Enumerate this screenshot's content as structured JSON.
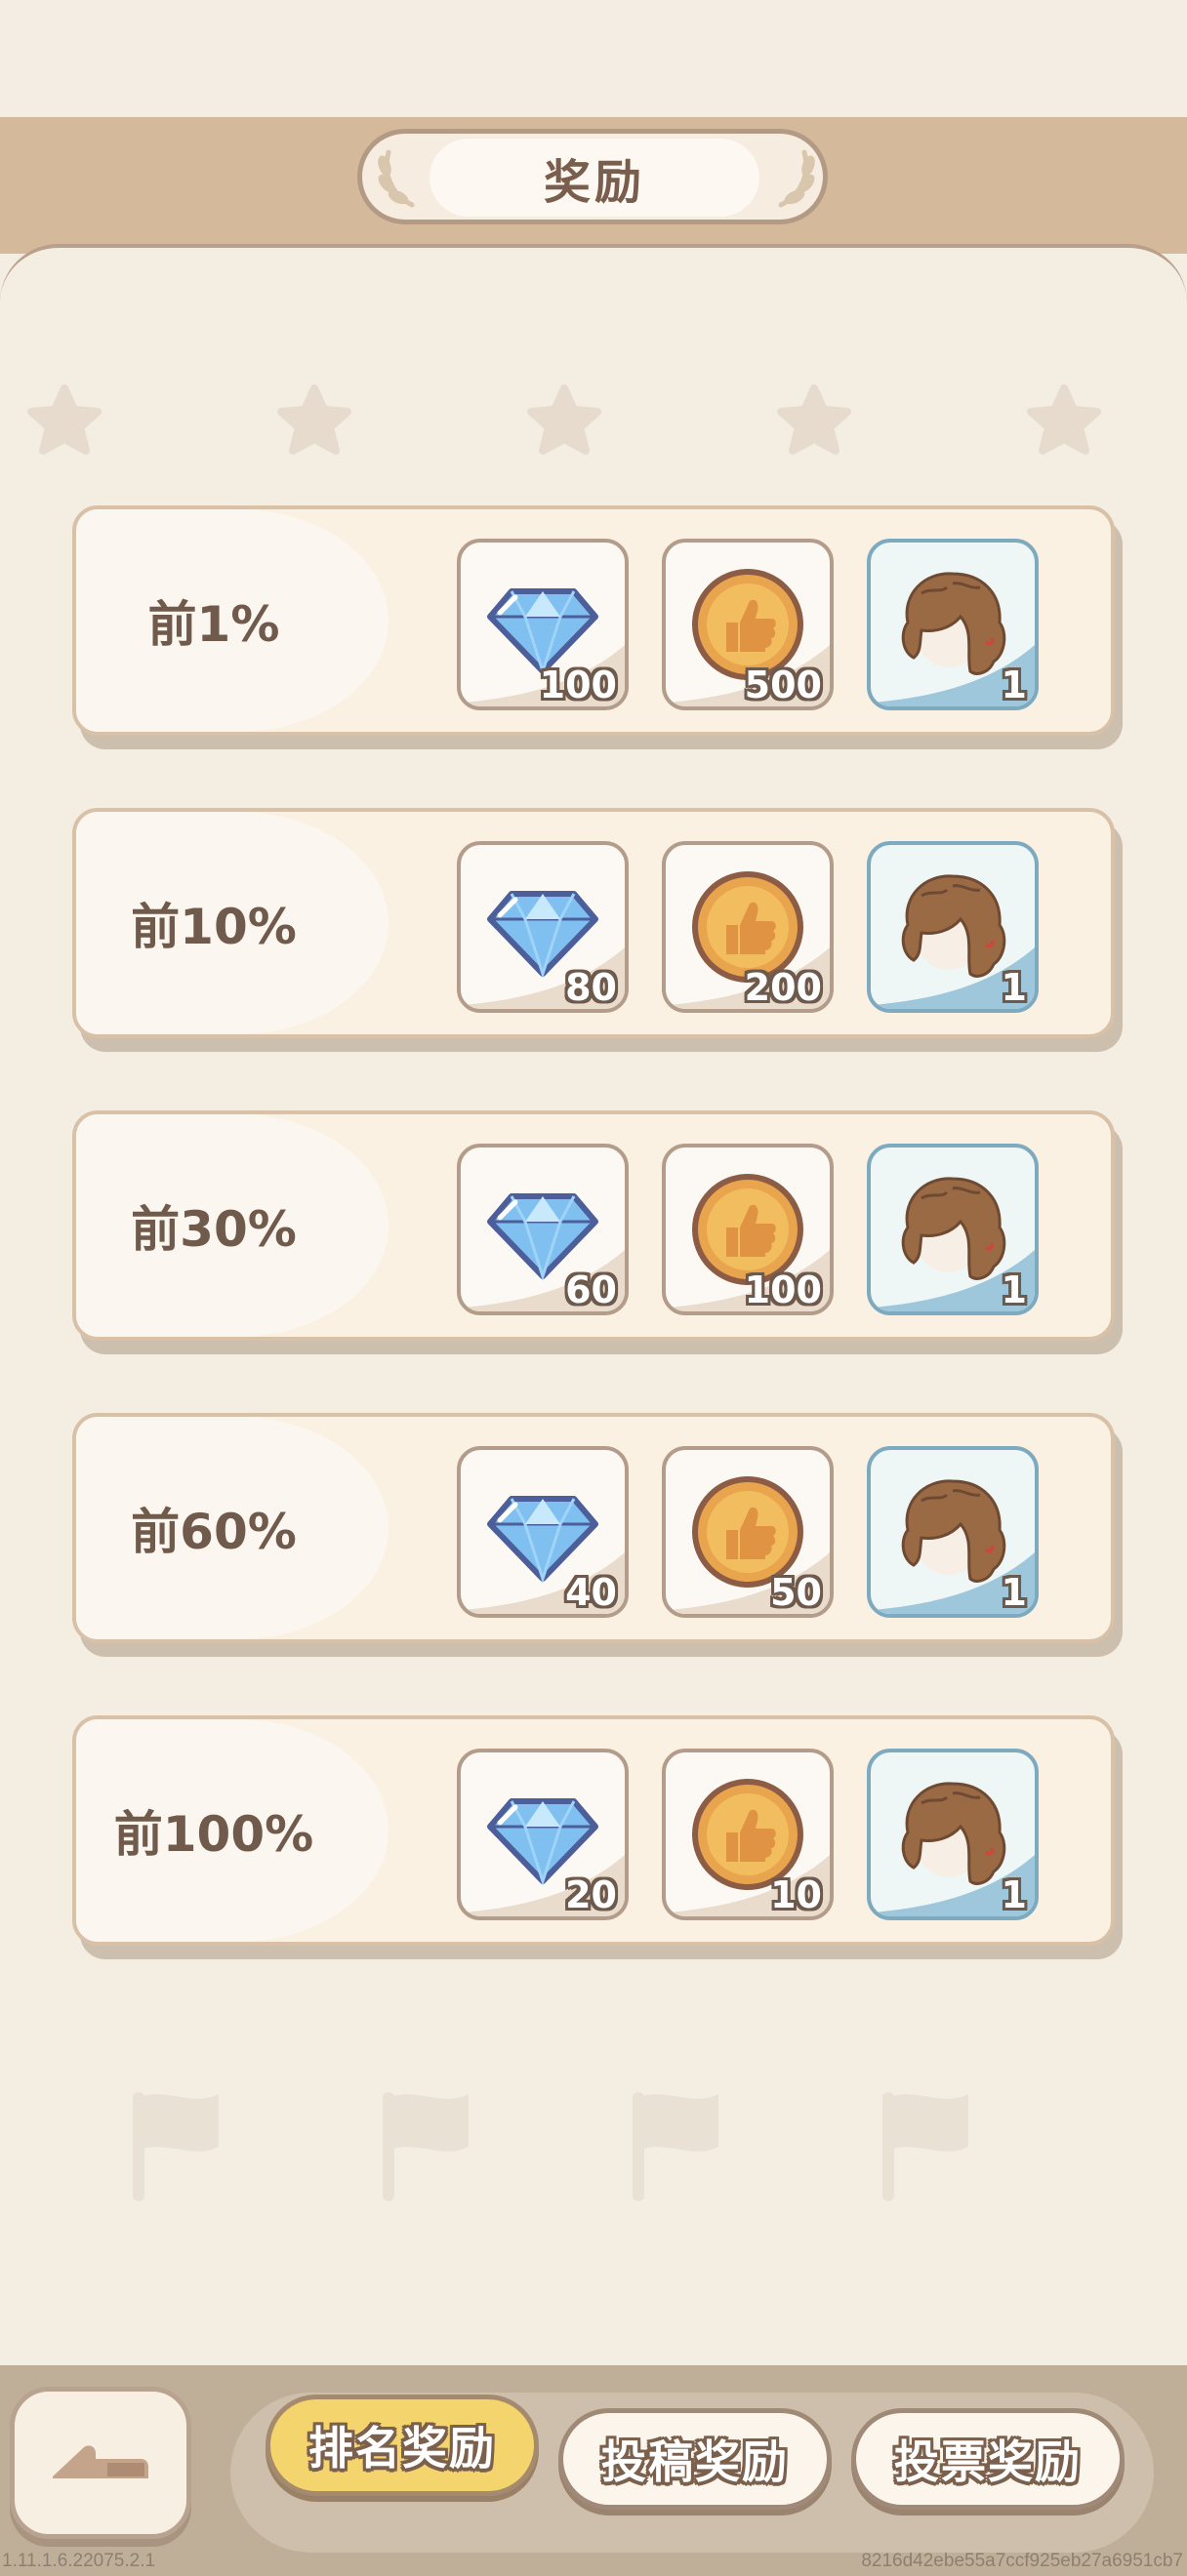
{
  "header": {
    "title": "奖励"
  },
  "rewards": [
    {
      "rank": "前1%",
      "diamond": "100",
      "coin": "500",
      "hair": "1"
    },
    {
      "rank": "前10%",
      "diamond": "80",
      "coin": "200",
      "hair": "1"
    },
    {
      "rank": "前30%",
      "diamond": "60",
      "coin": "100",
      "hair": "1"
    },
    {
      "rank": "前60%",
      "diamond": "40",
      "coin": "50",
      "hair": "1"
    },
    {
      "rank": "前100%",
      "diamond": "20",
      "coin": "10",
      "hair": "1"
    }
  ],
  "tabs": [
    {
      "label": "排名奖励",
      "active": true
    },
    {
      "label": "投稿奖励",
      "active": false
    },
    {
      "label": "投票奖励",
      "active": false
    }
  ],
  "footer": {
    "version": "1.11.1.6.22075.2.1",
    "hash": "8216d42ebe55a7ccf925eb27a6951cb7"
  },
  "colors": {
    "accent_tab": "#f3d46d",
    "panel_bg": "#f3ede2",
    "header_band": "#d4b99a",
    "text_brown": "#705a4b"
  },
  "icons": {
    "diamond": "diamond-icon",
    "coin": "thumbs-up-coin-icon",
    "hair": "curly-hair-icon",
    "back": "back-arrow-icon"
  }
}
